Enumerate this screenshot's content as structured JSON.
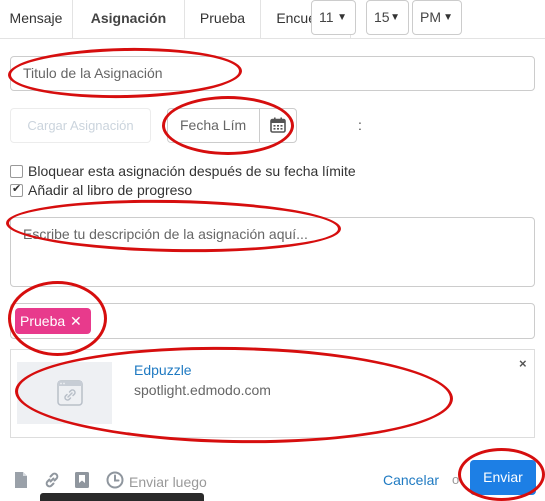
{
  "tabs": [
    {
      "label": "Mensaje"
    },
    {
      "label": "Asignación"
    },
    {
      "label": "Prueba"
    },
    {
      "label": "Encuesta"
    }
  ],
  "form": {
    "title_placeholder": "Titulo de la Asignación",
    "load_button": "Cargar Asignación",
    "date_placeholder": "Fecha Lím",
    "hour": "11",
    "minute": "15",
    "ampm": "PM",
    "time_separator": ":",
    "lock_label": "Bloquear esta asignación después de su fecha límite",
    "lock_checked": false,
    "gradebook_label": "Añadir al libro de progreso",
    "gradebook_checked": true,
    "description_placeholder": "Escribe tu descripción de la asignación aquí..."
  },
  "tags": [
    {
      "label": "Prueba",
      "remove": "✕",
      "color": "#e83a8c"
    }
  ],
  "link_card": {
    "title": "Edpuzzle",
    "url": "spotlight.edmodo.com",
    "close": "×",
    "thumbnail_icon": "link-icon"
  },
  "footer": {
    "icons": [
      "file-icon",
      "link-icon",
      "bookmark-icon",
      "clock-icon"
    ],
    "send_later": "Enviar luego",
    "cancel": "Cancelar",
    "or": "o",
    "submit": "Enviar",
    "submit_color": "#1d7fe5"
  },
  "annotation_color": "#d60e0e"
}
